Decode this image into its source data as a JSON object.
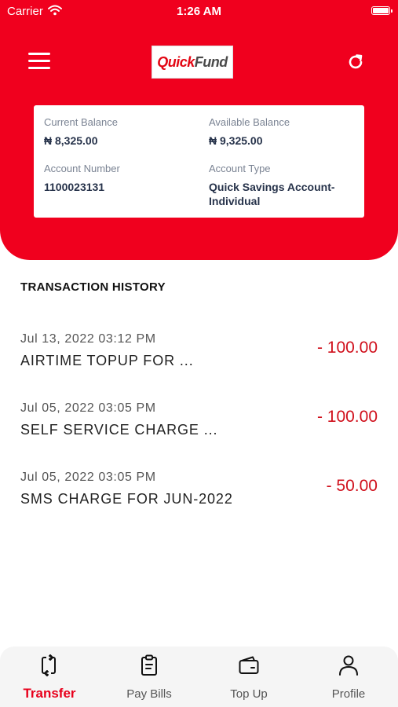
{
  "status_bar": {
    "carrier": "Carrier",
    "time": "1:26 AM"
  },
  "header": {
    "logo_part1": "Quick",
    "logo_part2": "Fund",
    "brand_color": "#f0001e"
  },
  "account": {
    "current_balance_label": "Current Balance",
    "current_balance": "₦ 8,325.00",
    "available_balance_label": "Available Balance",
    "available_balance": "₦ 9,325.00",
    "account_number_label": "Account Number",
    "account_number": "1100023131",
    "account_type_label": "Account Type",
    "account_type": "Quick Savings Account-Individual"
  },
  "history": {
    "title": "TRANSACTION HISTORY",
    "items": [
      {
        "date": "Jul 13, 2022 03:12 PM",
        "description": "AIRTIME TOPUP FOR ...",
        "amount": "- 100.00"
      },
      {
        "date": "Jul 05, 2022 03:05 PM",
        "description": "SELF SERVICE CHARGE ...",
        "amount": "- 100.00"
      },
      {
        "date": "Jul 05, 2022 03:05 PM",
        "description": "SMS CHARGE FOR JUN-2022",
        "amount": "- 50.00"
      }
    ]
  },
  "tabs": [
    {
      "label": "Transfer",
      "icon": "transfer-icon",
      "active": true
    },
    {
      "label": "Pay Bills",
      "icon": "clipboard-icon",
      "active": false
    },
    {
      "label": "Top Up",
      "icon": "wallet-icon",
      "active": false
    },
    {
      "label": "Profile",
      "icon": "user-icon",
      "active": false
    }
  ]
}
